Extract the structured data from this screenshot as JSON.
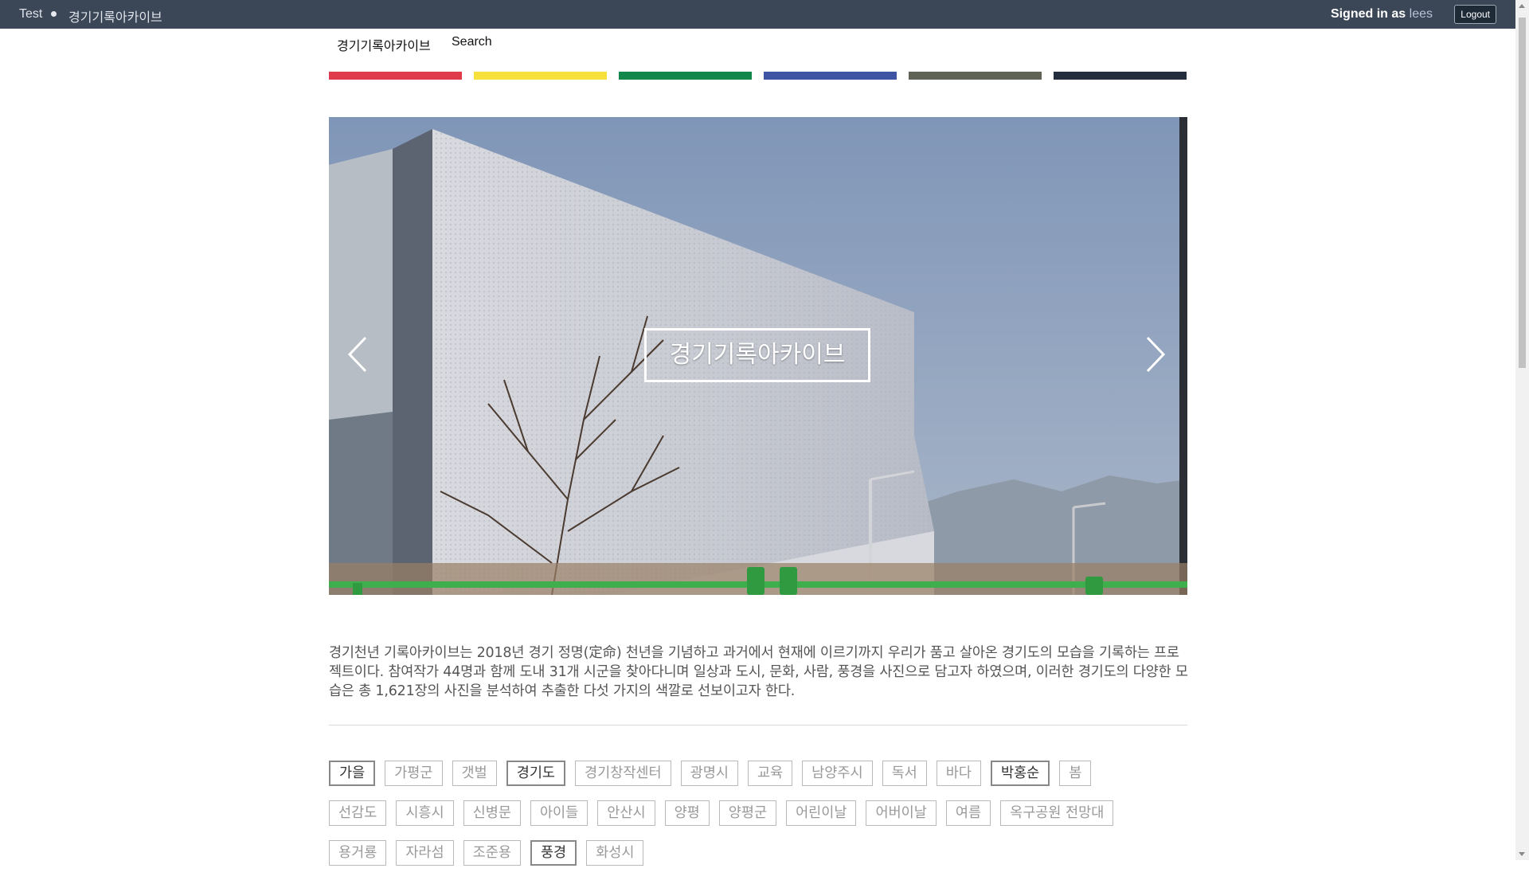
{
  "topbar": {
    "crumb_test": "Test",
    "crumb_site": "경기기록아카이브",
    "signed_in_prefix": "Signed in as",
    "user": "lees",
    "logout_label": "Logout"
  },
  "nav": {
    "home": "경기기록아카이브",
    "search": "Search"
  },
  "color_bars": [
    "#e03b4a",
    "#f7e03c",
    "#11874b",
    "#3f55a3",
    "#5f6355",
    "#232d3b"
  ],
  "hero": {
    "title": "경기기록아카이브",
    "prev_icon": "chevron-left-icon",
    "next_icon": "chevron-right-icon"
  },
  "description": "경기천년 기록아카이브는 2018년 경기 정명(定命) 천년을 기념하고 과거에서 현재에 이르기까지 우리가 품고 살아온 경기도의 모습을 기록하는 프로젝트이다.  참여작가 44명과 함께 도내 31개 시군을 찾아다니며 일상과 도시, 문화, 사람, 풍경을 사진으로 담고자 하였으며, 이러한 경기도의 다양한 모습은 총 1,621장의 사진을 분석하여 추출한 다섯 가지의 색깔로 선보이고자 한다.",
  "tags": {
    "row1": [
      "가을",
      "가평군",
      "갯벌",
      "경기도",
      "경기창작센터",
      "광명시",
      "교육",
      "남양주시",
      "독서",
      "바다",
      "박홍순",
      "봄"
    ],
    "row2": [
      "선감도",
      "시흥시",
      "신병문",
      "아이들",
      "안산시",
      "양평",
      "양평군",
      "어린이날",
      "어버이날",
      "여름",
      "옥구공원 전망대"
    ],
    "row3": [
      "용거룡",
      "자라섬",
      "조준용",
      "풍경",
      "화성시"
    ],
    "active": [
      "가을",
      "경기도",
      "박홍순",
      "풍경"
    ]
  }
}
